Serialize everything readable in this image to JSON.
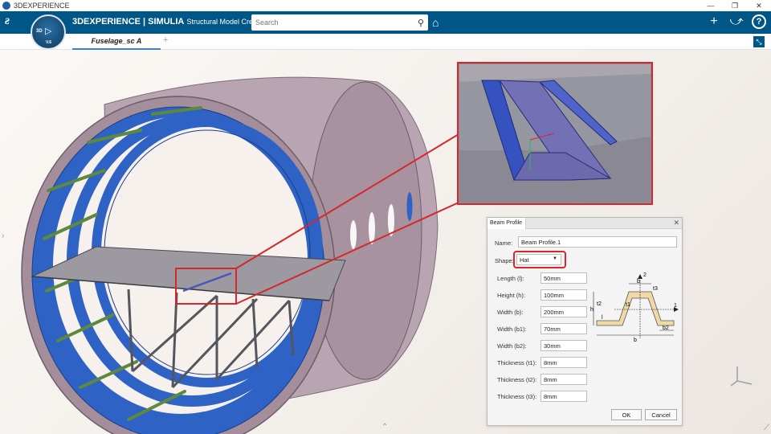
{
  "window": {
    "title": "3DEXPERIENCE",
    "controls": [
      "—",
      "❐",
      "✕"
    ]
  },
  "header": {
    "brand_bold": "3DEXPERIENCE | SIMULIA",
    "app_name": "Structural Model Creation",
    "search_placeholder": "Search",
    "actions": {
      "add": "+",
      "share": "⤻",
      "help": "?"
    }
  },
  "compass": {
    "label": "3D",
    "version": "V.6"
  },
  "tabs": [
    {
      "label": "Fuselage_sc A",
      "active": true
    }
  ],
  "tab_add": "+",
  "dialog": {
    "tab_label": "Beam Profile",
    "name_label": "Name:",
    "name_value": "Beam Profile.1",
    "shape_label": "Shape:",
    "shape_value": "Hat",
    "fields": [
      {
        "label": "Length (l):",
        "value": "50mm"
      },
      {
        "label": "Height (h):",
        "value": "100mm"
      },
      {
        "label": "Width (b):",
        "value": "200mm"
      },
      {
        "label": "Width (b1):",
        "value": "70mm"
      },
      {
        "label": "Width (b2):",
        "value": "30mm"
      },
      {
        "label": "Thickness (t1):",
        "value": "8mm"
      },
      {
        "label": "Thickness (t2):",
        "value": "8mm"
      },
      {
        "label": "Thickness (t3):",
        "value": "8mm"
      }
    ],
    "ok_label": "OK",
    "cancel_label": "Cancel",
    "diagram_labels": {
      "axis2": "2",
      "axis1": "1",
      "b1": "b",
      "t3": "t3",
      "t1": "t1",
      "t2": "t2",
      "h": "h",
      "l": "l",
      "b": "b",
      "b2": "b2"
    }
  },
  "colors": {
    "header": "#005686",
    "ring": "#2e62c4",
    "shell": "#b6a1ad",
    "highlight": "#d7262c",
    "profile_fill": "#f0d9a6"
  }
}
